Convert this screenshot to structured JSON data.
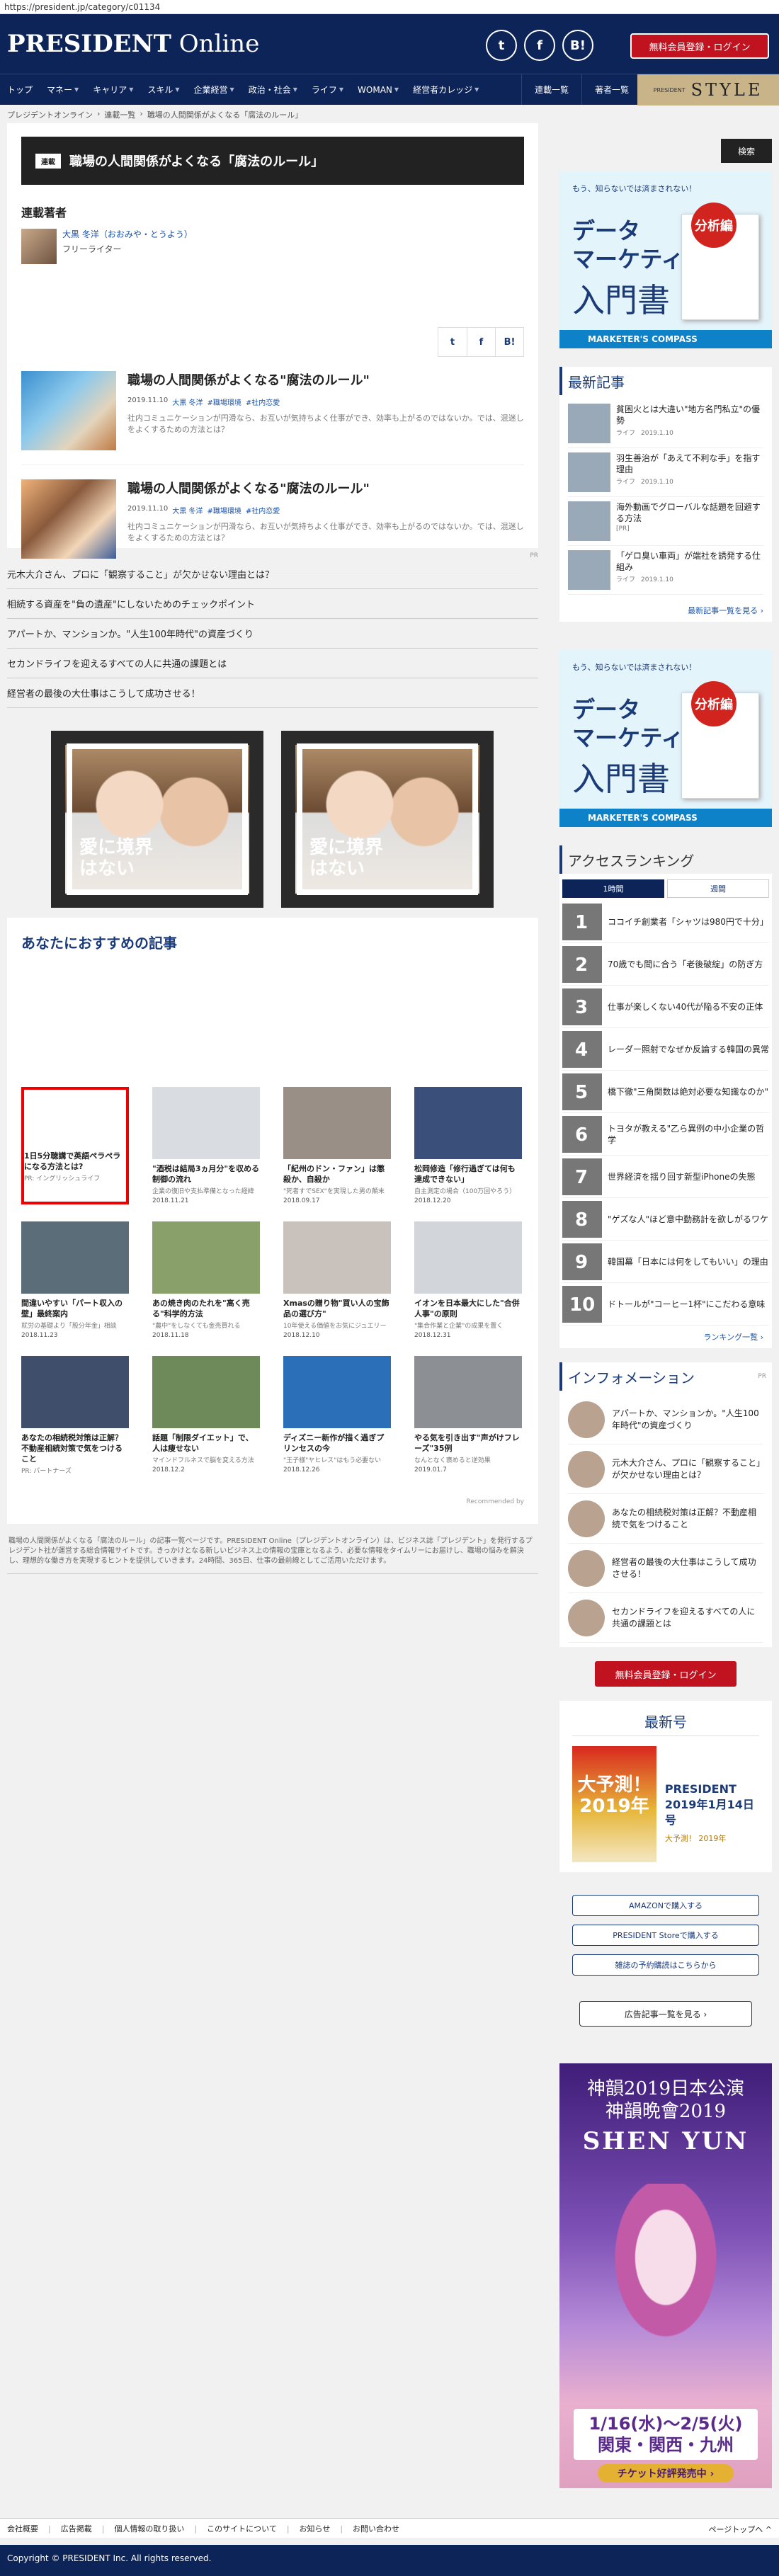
{
  "url": "https://president.jp/category/c01134",
  "brand": {
    "logo_bold": "PRESIDENT",
    "logo_rest": " Online",
    "register_btn": "無料会員登録・ログイン"
  },
  "social": [
    "t",
    "f",
    "B!"
  ],
  "nav": {
    "main": [
      {
        "label": "トップ",
        "caret": false
      },
      {
        "label": "マネー",
        "caret": true
      },
      {
        "label": "キャリア",
        "caret": true
      },
      {
        "label": "スキル",
        "caret": true
      },
      {
        "label": "企業経営",
        "caret": true
      },
      {
        "label": "政治・社会",
        "caret": true
      },
      {
        "label": "ライフ",
        "caret": true
      },
      {
        "label": "WOMAN",
        "caret": true
      },
      {
        "label": "経営者カレッジ",
        "caret": true
      }
    ],
    "sub": [
      "連載一覧",
      "著者一覧"
    ],
    "style_small": "PRESIDENT",
    "style_big": "STYLE"
  },
  "breadcrumb": [
    "プレジデントオンライン",
    "›",
    "連載一覧",
    "›",
    "職場の人間関係がよくなる「腐法のルール」"
  ],
  "series": {
    "tag": "連載",
    "title": "職場の人間関係がよくなる「腐法のルール」"
  },
  "author_section": "連載著者",
  "author": {
    "name": "大黒 冬洋（おおみや・とうよう）",
    "role": "フリーライター"
  },
  "share": [
    "t",
    "f",
    "B!"
  ],
  "articles": [
    {
      "title": "職場の人間関係がよくなる\"腐法のルール\"",
      "date": "2019.11.10",
      "author": "大黒 冬洋",
      "tag1": "#職場環境",
      "tag2": "#社内恋愛",
      "desc": "社内コミュニケーションが円滑なら、お互いが気持ちよく仕事ができ、効率も上がるのではないか。では、混迷しをよくするための方法とは？"
    },
    {
      "title": "職場の人間関係がよくなる\"腐法のルール\"",
      "date": "2019.11.10",
      "author": "大黒 冬洋",
      "tag1": "#職場環境",
      "tag2": "#社内恋愛",
      "desc": "社内コミュニケーションが円滑なら、お互いが気持ちよく仕事ができ、効率も上がるのではないか。では、混迷しをよくするための方法とは？"
    }
  ],
  "pr_label": "PR",
  "pr_links": [
    "元木大介さん、プロに「観察すること」が欠かせない理由とは？",
    "相続する資産を\"負の遺産\"にしないためのチェックポイント",
    "アパートか、マンションか。\"人生100年時代\"の資産づくり",
    "セカンドライフを迎えるすべての人に共通の課題とは",
    "経営者の最後の大仕事はこうして成功させる！"
  ],
  "banner_copy": "愛に境界はない",
  "recommend": {
    "title": "あなたにおすすめの記事",
    "items": [
      {
        "t": "1日5分聴講で英語ペラペラになる方法とは?",
        "s": "PR: イングリッシュライフ",
        "d": ""
      },
      {
        "t": "\"酒税は結局3ヵ月分\"を収める制御の流れ",
        "s": "企業の復旧や支払準備となった経緯",
        "d": "2018.11.21"
      },
      {
        "t": "「紀州のドン・ファン」は懲殺か、自殺か",
        "s": "\"死者すでSEX\"を実現した男の顛末",
        "d": "2018.09.17"
      },
      {
        "t": "松岡修造「修行過ぎては何も達成できない」",
        "s": "自主測定の場合（100万回やろう）",
        "d": "2018.12.20"
      },
      {
        "t": "間違いやすい「パート収入の壁」最終案内",
        "s": "就労の基礎より「股分年金」相談",
        "d": "2018.11.23"
      },
      {
        "t": "あの焼き肉のたれを\"高く売る\"科学的方法",
        "s": "\"農中\"をしなくても金売買れる",
        "d": "2018.11.18"
      },
      {
        "t": "Xmasの贈り物\"買い人の宝飾品の選び方\"",
        "s": "10年使える価値をお気にジュエリー",
        "d": "2018.12.10"
      },
      {
        "t": "イオンを日本最大にした\"合併人事\"の原則",
        "s": "\"集合作業と企業\"の成果を置く",
        "d": "2018.12.31"
      },
      {
        "t": "あなたの相続税対策は正解？不動産相続対策で気をつけること",
        "s": "PR: パートナーズ",
        "d": ""
      },
      {
        "t": "話題「制限ダイエット」で、人は痩せない",
        "s": "マインドフルネスで脳を変える方法",
        "d": "2018.12.2"
      },
      {
        "t": "ディズニー新作が描く過ぎプリンセスの今",
        "s": "\"王子様\"ヤヒレス\"はもう必要ない",
        "d": "2018.12.26"
      },
      {
        "t": "やる気を引き出す\"声がけフレーズ\"35例",
        "s": "なんとなく褒めると逆効果",
        "d": "2019.01.7"
      }
    ],
    "by": "Recommended by"
  },
  "footnote": "職場の人間関係がよくなる「腐法のルール」の記事一覧ページです。PRESIDENT Online（プレジデントオンライン）は、ビジネス誌「プレジデント」を発行するプレジデント社が運営する総合情報サイトです。きっかけとなる新しいビジネス上の情報の宝庫となるよう、必要な情報をタイムリーにお届けし、職場の悩みを解決し、理想的な働き方を実現するヒントを提供していきます。24時間、365日、仕事の最前線としてご活用いただけます。",
  "sidebar": {
    "search_btn": "検索",
    "ad": {
      "label": "もう、知らないでは済まされない！",
      "head": "データ\nマーケティング",
      "book": "入門書",
      "badge": "分析編",
      "foot": "MARKETER'S COMPASS"
    },
    "latest_h": "最新記事",
    "latest": [
      {
        "t": "貧困火とは大違い\"地方名門私立\"の優勢",
        "c": "ライフ",
        "d": "2019.1.10"
      },
      {
        "t": "羽生善治が「あえて不利な手」を指す理由",
        "c": "ライフ",
        "d": "2019.1.10"
      },
      {
        "t": "海外動画でグローバルな話題を回避する方法",
        "c": "[PR]",
        "d": ""
      },
      {
        "t": "「ゲロ臭い車両」が端社を誘発する仕組み",
        "c": "ライフ",
        "d": "2019.1.10"
      }
    ],
    "latest_more": "最新記事一覧を見る ›",
    "rank_h": "アクセスランキング",
    "rank_tabs": [
      "1時間",
      "週間"
    ],
    "ranks": [
      {
        "n": "1",
        "t": "ココイチ創業者「シャツは980円で十分」"
      },
      {
        "n": "2",
        "t": "70歳でも聞に合う「老後破綻」の防ぎ方"
      },
      {
        "n": "3",
        "t": "仕事が楽しくない40代が陥る不安の正体"
      },
      {
        "n": "4",
        "t": "レーダー照射でなぜか反論する韓国の異常"
      },
      {
        "n": "5",
        "t": "橋下徹\"三角関数は絶対必要な知識なのか\""
      },
      {
        "n": "6",
        "t": "トヨタが教える\"乙ら異例の中小企業の哲学"
      },
      {
        "n": "7",
        "t": "世界経済を揺り回す新型iPhoneの失態"
      },
      {
        "n": "8",
        "t": "\"ゲズな人\"ほど意中勤務計を欲しがるワケ"
      },
      {
        "n": "9",
        "t": "韓国幕「日本には何をしてもいい」の理由"
      },
      {
        "n": "10",
        "t": "ドトールが\"コーヒー1杯\"にこだわる意味"
      }
    ],
    "rank_more": "ランキング一覧 ›",
    "info_h": "インフォメーション",
    "info_pr": "PR",
    "info": [
      "アパートか、マンションか。\"人生100年時代\"の資産づくり",
      "元木大介さん、プロに「観察すること」が欠かせない理由とは？",
      "あなたの相続税対策は正解？不動産相続で気をつけること",
      "経営者の最後の大仕事はこうして成功させる！",
      "セカンドライフを迎えるすべての人に共通の課題とは"
    ],
    "register_btn": "無料会員登録・ログイン",
    "issue": {
      "h": "最新号",
      "cover": "大予測！2019年",
      "title": "PRESIDENT\n2019年1月14日号",
      "sub": "大予測！ 2019年"
    },
    "buttons": [
      "AMAZONで購入する",
      "PRESIDENT Storeで購入する",
      "雑誌の予約購読はこちらから"
    ],
    "adlist": "広告記事一覧を見る ›",
    "shenyun": {
      "a": "神韻2019日本公演\n神韻晩會2019",
      "b": "SHEN YUN",
      "date": "1/16(水)〜2/5(火)\n関東・関西・九州",
      "ticket": "チケット好評発売中 ›"
    }
  },
  "footer": {
    "links": [
      "会社概要",
      "広告掲載",
      "個人情報の取り扱い",
      "このサイトについて",
      "お知らせ",
      "お問い合わせ"
    ],
    "pagetop": "ページトップへ ^",
    "copyright": "Copyright © PRESIDENT Inc. All rights reserved."
  }
}
